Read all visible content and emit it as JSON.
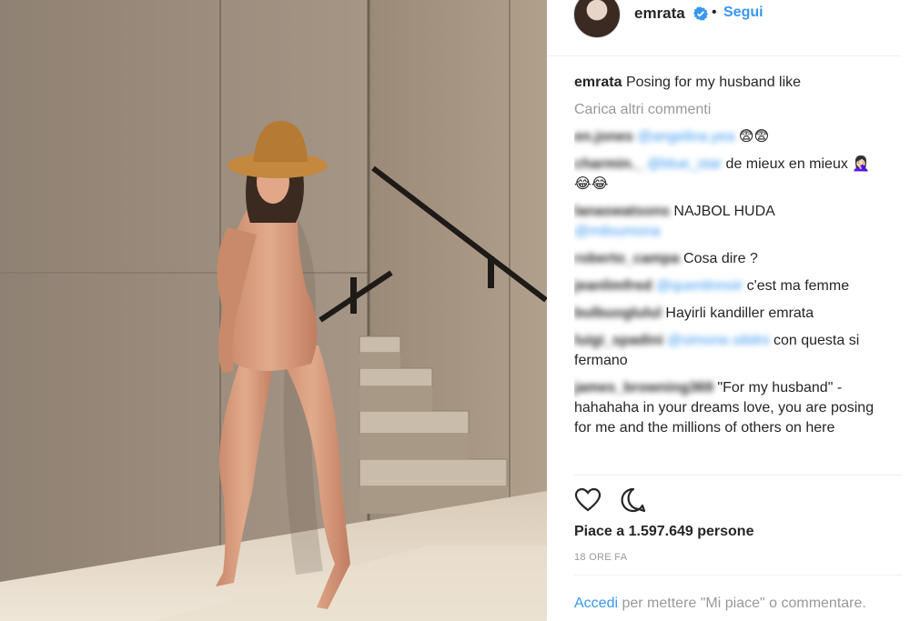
{
  "post": {
    "username": "emrata",
    "separator": "•",
    "follow_label": "Segui",
    "caption_user": "emrata",
    "caption_text": "Posing for my husband like",
    "load_more": "Carica altri commenti",
    "likes": "Piace a 1.597.649 persone",
    "time": "18 ORE FA",
    "login_link": "Accedi",
    "login_text": " per mettere \"Mi piace\" o commentare.",
    "more": "..."
  },
  "comments": [
    {
      "user": "en.jones",
      "mention": "@angelina.yea",
      "text": " 😨😨"
    },
    {
      "user": "charmin._",
      "mention": "@blue_star",
      "text": " de mieux en mieux 🤦🏻‍♀️😂😂"
    },
    {
      "user": "lanaswatsons",
      "mention": "@miloumona",
      "text": " NAJBOL HUDA",
      "mention_after": true
    },
    {
      "user": "roberto_campa",
      "mention": "",
      "text": " Cosa dire ?"
    },
    {
      "user": "jeanlimfred",
      "mention": "@quentinnoir",
      "text": " c'est ma femme"
    },
    {
      "user": "bulbuoglulul",
      "mention": "",
      "text": " Hayirli kandiller emrata"
    },
    {
      "user": "luigi_spadini",
      "mention": "@simone.sibilni",
      "text": " con questa si fermano"
    },
    {
      "user": "james_browning369",
      "mention": "",
      "text": " \"For my husband\" - hahahaha in your dreams love, you are posing for me and the millions of others on here"
    }
  ],
  "colors": {
    "link_blue": "#3897f0",
    "text": "#262626",
    "muted": "#999999",
    "divider": "#efefef"
  },
  "icons": [
    "verified-badge-icon",
    "heart-icon",
    "comment-bubble-icon"
  ]
}
